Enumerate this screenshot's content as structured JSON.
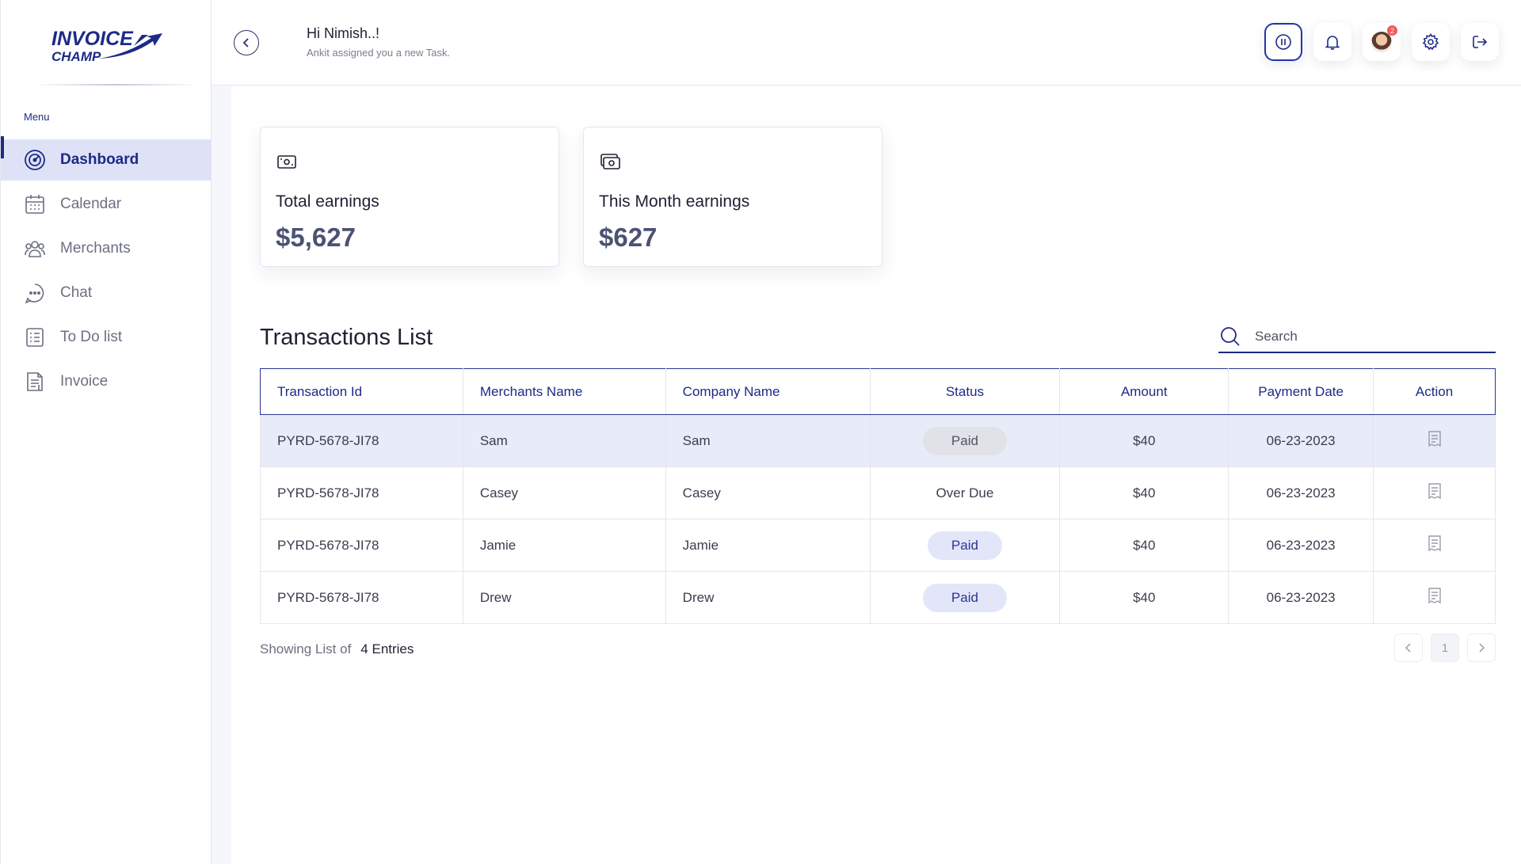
{
  "brand": {
    "line1": "INVOICE",
    "line2": "CHAMP",
    "color": "#1d2a86"
  },
  "sidebar": {
    "menu_label": "Menu",
    "items": [
      {
        "label": "Dashboard",
        "icon": "dashboard-icon",
        "active": true
      },
      {
        "label": "Calendar",
        "icon": "calendar-icon"
      },
      {
        "label": "Merchants",
        "icon": "merchants-icon"
      },
      {
        "label": "Chat",
        "icon": "chat-icon"
      },
      {
        "label": "To Do list",
        "icon": "todo-list-icon"
      },
      {
        "label": "Invoice",
        "icon": "invoice-icon"
      }
    ]
  },
  "header": {
    "greeting": "Hi Nimish..!",
    "subtext": "Ankit assigned you a new Task.",
    "notification_badge": "2"
  },
  "cards": [
    {
      "label": "Total earnings",
      "value": "$5,627",
      "icon": "wallet-icon"
    },
    {
      "label": "This Month earnings",
      "value": "$627",
      "icon": "cash-icon"
    }
  ],
  "transactions": {
    "title": "Transactions List",
    "search_placeholder": "Search",
    "columns": [
      "Transaction Id",
      "Merchants Name",
      "Company Name",
      "Status",
      "Amount",
      "Payment Date",
      "Action"
    ],
    "rows": [
      {
        "id": "PYRD-5678-JI78",
        "merchant": "Sam",
        "company": "Sam",
        "status": "Paid",
        "amount": "$40",
        "date": "06-23-2023"
      },
      {
        "id": "PYRD-5678-JI78",
        "merchant": "Casey",
        "company": "Casey",
        "status": "Over Due",
        "amount": "$40",
        "date": "06-23-2023"
      },
      {
        "id": "PYRD-5678-JI78",
        "merchant": "Jamie",
        "company": "Jamie",
        "status": "Paid",
        "amount": "$40",
        "date": "06-23-2023"
      },
      {
        "id": "PYRD-5678-JI78",
        "merchant": "Drew",
        "company": "Drew",
        "status": "Paid",
        "amount": "$40",
        "date": "06-23-2023"
      }
    ],
    "footer_label": "Showing List of",
    "footer_count": "4 Entries",
    "page": "1"
  }
}
